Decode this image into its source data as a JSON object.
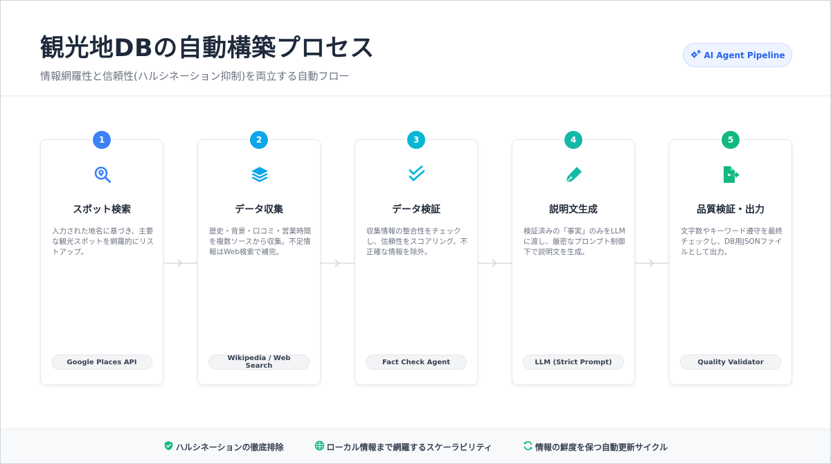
{
  "header": {
    "title": "観光地DBの自動構築プロセス",
    "subtitle": "情報網羅性と信頼性(ハルシネーション抑制)を両立する自動フロー",
    "badge": {
      "label": "AI Agent Pipeline",
      "icon": "gears-icon",
      "color": "#2563eb"
    }
  },
  "steps": [
    {
      "number": "1",
      "title": "スポット検索",
      "description": "入力された地名に基づき、主要な観光スポットを網羅的にリストアップ。",
      "tag": "Google Places API",
      "icon": "location-search-icon",
      "color": "#3b82f6"
    },
    {
      "number": "2",
      "title": "データ収集",
      "description": "歴史・背景・口コミ・営業時間を複数ソースから収集。不足情報はWeb検索で補完。",
      "tag": "Wikipedia / Web Search",
      "icon": "layers-icon",
      "color": "#0ea5e9"
    },
    {
      "number": "3",
      "title": "データ検証",
      "description": "収集情報の整合性をチェックし、信頼性をスコアリング。不正確な情報を除外。",
      "tag": "Fact Check Agent",
      "icon": "double-check-icon",
      "color": "#06b6d4"
    },
    {
      "number": "4",
      "title": "説明文生成",
      "description": "検証済みの「事実」のみをLLMに渡し、厳密なプロンプト制御下で説明文を生成。",
      "tag": "LLM (Strict Prompt)",
      "icon": "pen-nib-icon",
      "color": "#14b8a6"
    },
    {
      "number": "5",
      "title": "品質検証・出力",
      "description": "文字数やキーワード遵守を最終チェックし、DB用JSONファイルとして出力。",
      "tag": "Quality Validator",
      "icon": "file-export-icon",
      "color": "#10b981"
    }
  ],
  "footer": {
    "items": [
      {
        "label": "ハルシネーションの徹底排除",
        "icon": "shield-check-icon",
        "color": "#10b981"
      },
      {
        "label": "ローカル情報まで網羅するスケーラビリティ",
        "icon": "globe-icon",
        "color": "#10b981"
      },
      {
        "label": "情報の鮮度を保つ自動更新サイクル",
        "icon": "sync-icon",
        "color": "#10b981"
      }
    ]
  }
}
